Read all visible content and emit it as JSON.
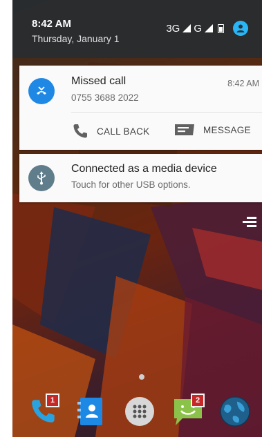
{
  "status_bar": {
    "time": "8:42 AM",
    "date": "Thursday, January 1",
    "network_1": "3G",
    "network_2": "G"
  },
  "notifications": [
    {
      "title": "Missed call",
      "number": "0755 3688 2022",
      "time": "8:42 AM",
      "actions": [
        {
          "label": "CALL BACK",
          "icon": "phone-icon"
        },
        {
          "label": "MESSAGE",
          "icon": "message-icon"
        }
      ]
    },
    {
      "title": "Connected as a media device",
      "subtitle": "Touch for other USB options."
    }
  ],
  "dock": {
    "apps": [
      {
        "name": "phone",
        "badge": "1"
      },
      {
        "name": "contacts"
      },
      {
        "name": "app-drawer"
      },
      {
        "name": "messaging",
        "badge": "2"
      },
      {
        "name": "browser"
      }
    ]
  },
  "colors": {
    "call_accent": "#1f88e5",
    "usb_accent": "#607d8b",
    "badge": "#c62828",
    "shade": "#2c3034"
  }
}
